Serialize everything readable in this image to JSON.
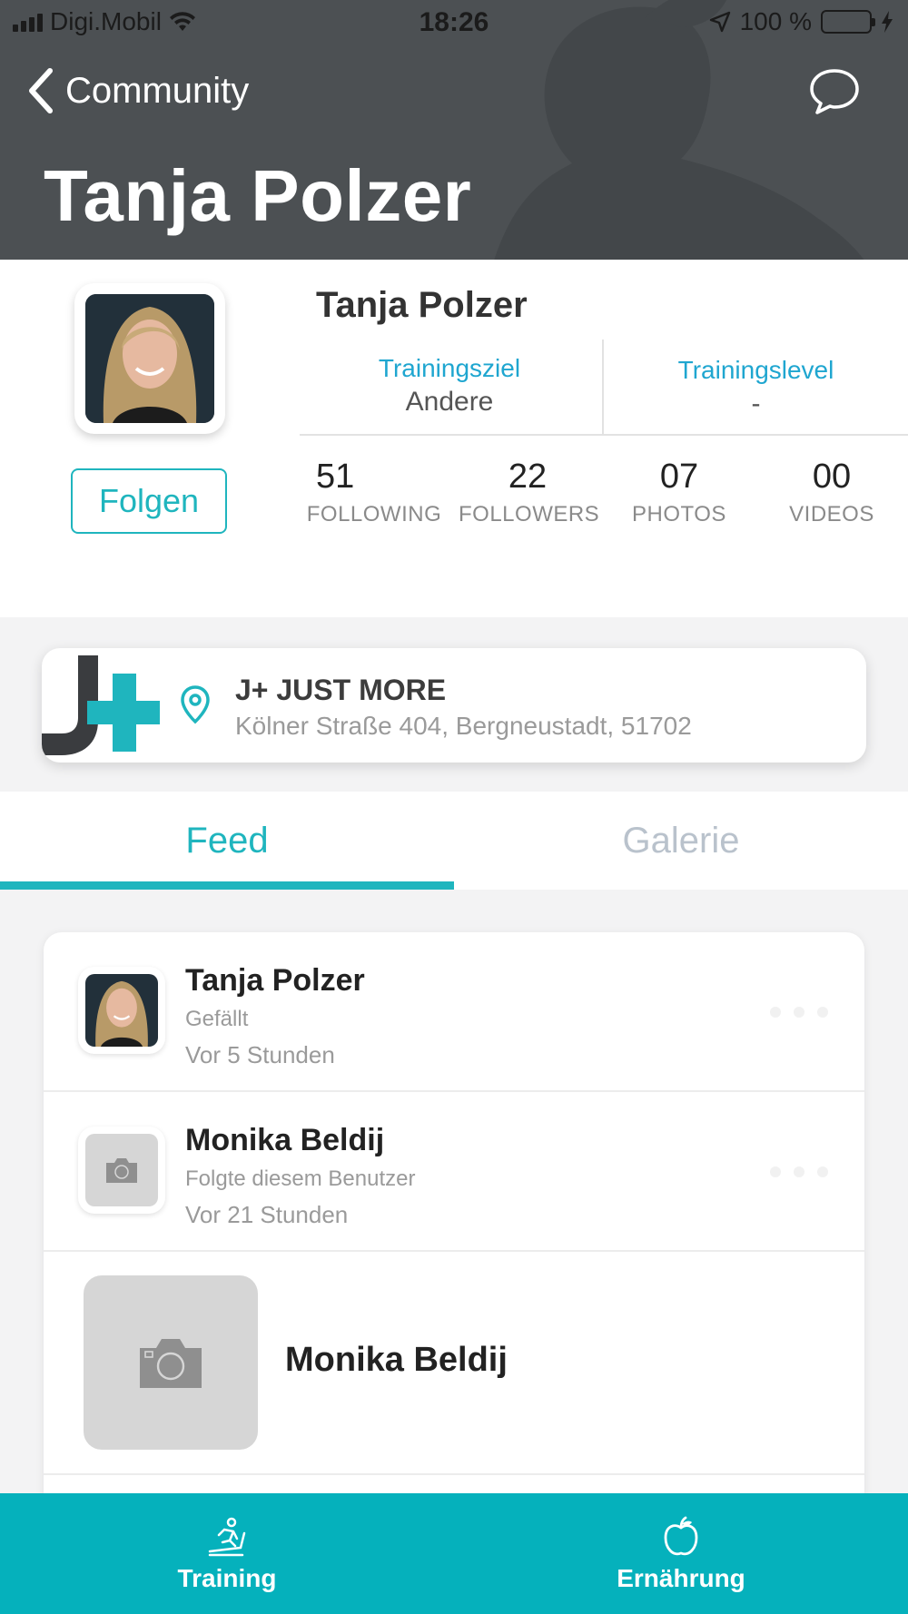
{
  "status_bar": {
    "carrier": "Digi.Mobil",
    "time": "18:26",
    "battery": "100 %"
  },
  "header": {
    "back_label": "Community",
    "title": "Tanja Polzer"
  },
  "profile": {
    "name": "Tanja Polzer",
    "follow_label": "Folgen",
    "goal": {
      "label": "Trainingsziel",
      "value": "Andere"
    },
    "level": {
      "label": "Trainingslevel",
      "value": "-"
    },
    "stats": [
      {
        "value": "51",
        "label": "FOLLOWING"
      },
      {
        "value": "22",
        "label": "FOLLOWERS"
      },
      {
        "value": "07",
        "label": "PHOTOS"
      },
      {
        "value": "00",
        "label": "VIDEOS"
      }
    ]
  },
  "gym": {
    "name": "J+ JUST MORE",
    "address": "Kölner Straße 404, Bergneustadt, 51702"
  },
  "tabs": [
    {
      "label": "Feed",
      "active": true
    },
    {
      "label": "Galerie",
      "active": false
    }
  ],
  "feed": [
    {
      "name": "Tanja Polzer",
      "action": "Gefällt",
      "time": "Vor 5 Stunden"
    },
    {
      "name": "Monika Beldij",
      "action": "Folgte diesem Benutzer",
      "time": "Vor 21 Stunden"
    },
    {
      "name": "Monika Beldij"
    }
  ],
  "bottom_nav": [
    {
      "label": "Training",
      "icon": "treadmill-icon"
    },
    {
      "label": "Ernährung",
      "icon": "apple-icon"
    }
  ],
  "colors": {
    "accent": "#1fb5be",
    "bottom_bar": "#05b1bc",
    "header_bg": "#4c5053",
    "link_blue": "#1fa6d0"
  }
}
